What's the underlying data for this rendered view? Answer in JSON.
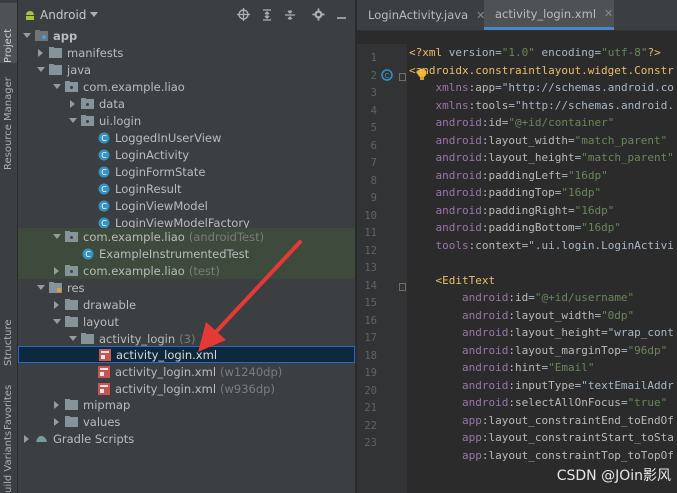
{
  "left_strip": {
    "project": "Project",
    "resource_manager": "Resource Manager",
    "structure": "Structure",
    "favorites": "Favorites",
    "build_variants": "uild Variants"
  },
  "panel": {
    "view_selector": "Android"
  },
  "tree": [
    {
      "label": "app",
      "sub": ""
    },
    {
      "label": "manifests",
      "sub": ""
    },
    {
      "label": "java",
      "sub": ""
    },
    {
      "label": "com.example.liao",
      "sub": ""
    },
    {
      "label": "data",
      "sub": ""
    },
    {
      "label": "ui.login",
      "sub": ""
    },
    {
      "label": "LoggedInUserView",
      "sub": ""
    },
    {
      "label": "LoginActivity",
      "sub": ""
    },
    {
      "label": "LoginFormState",
      "sub": ""
    },
    {
      "label": "LoginResult",
      "sub": ""
    },
    {
      "label": "LoginViewModel",
      "sub": ""
    },
    {
      "label": "LoginViewModelFactory",
      "sub": ""
    },
    {
      "label": "com.example.liao",
      "sub": "(androidTest)"
    },
    {
      "label": "ExampleInstrumentedTest",
      "sub": ""
    },
    {
      "label": "com.example.liao",
      "sub": "(test)"
    },
    {
      "label": "res",
      "sub": ""
    },
    {
      "label": "drawable",
      "sub": ""
    },
    {
      "label": "layout",
      "sub": ""
    },
    {
      "label": "activity_login",
      "sub": "(3)"
    },
    {
      "label": "activity_login.xml",
      "sub": ""
    },
    {
      "label": "activity_login.xml",
      "sub": "(w1240dp)"
    },
    {
      "label": "activity_login.xml",
      "sub": "(w936dp)"
    },
    {
      "label": "mipmap",
      "sub": ""
    },
    {
      "label": "values",
      "sub": ""
    },
    {
      "label": "Gradle Scripts",
      "sub": ""
    }
  ],
  "editor": {
    "tabs": [
      "LoginActivity.java",
      "activity_login.xml"
    ],
    "line_numbers": [
      "1",
      "2",
      "3",
      "4",
      "5",
      "6",
      "7",
      "8",
      "9",
      "10",
      "11",
      "12",
      "13",
      "14",
      "15",
      "16",
      "17",
      "18",
      "19",
      "20",
      "21",
      "22",
      "23"
    ],
    "code": [
      "<?xml version=\"1.0\" encoding=\"utf-8\"?>",
      "<androidx.constraintlayout.widget.Constr",
      "    xmlns:app=\"http://schemas.android.co",
      "    xmlns:tools=\"http://schemas.android.",
      "    android:id=\"@+id/container\"",
      "    android:layout_width=\"match_parent\"",
      "    android:layout_height=\"match_parent\"",
      "    android:paddingLeft=\"16dp\"",
      "    android:paddingTop=\"16dp\"",
      "    android:paddingRight=\"16dp\"",
      "    android:paddingBottom=\"16dp\"",
      "    tools:context=\".ui.login.LoginActivi",
      "",
      "    <EditText",
      "        android:id=\"@+id/username\"",
      "        android:layout_width=\"0dp\"",
      "        android:layout_height=\"wrap_cont",
      "        android:layout_marginTop=\"96dp\"",
      "        android:hint=\"Email\"",
      "        android:inputType=\"textEmailAddr",
      "        android:selectAllOnFocus=\"true\"",
      "        app:layout_constraintEnd_toEndOf",
      "        app:layout_constraintStart_toSta",
      "        app:layout_constraintTop_toTopOf"
    ]
  },
  "watermark": "CSDN @JOin影风"
}
